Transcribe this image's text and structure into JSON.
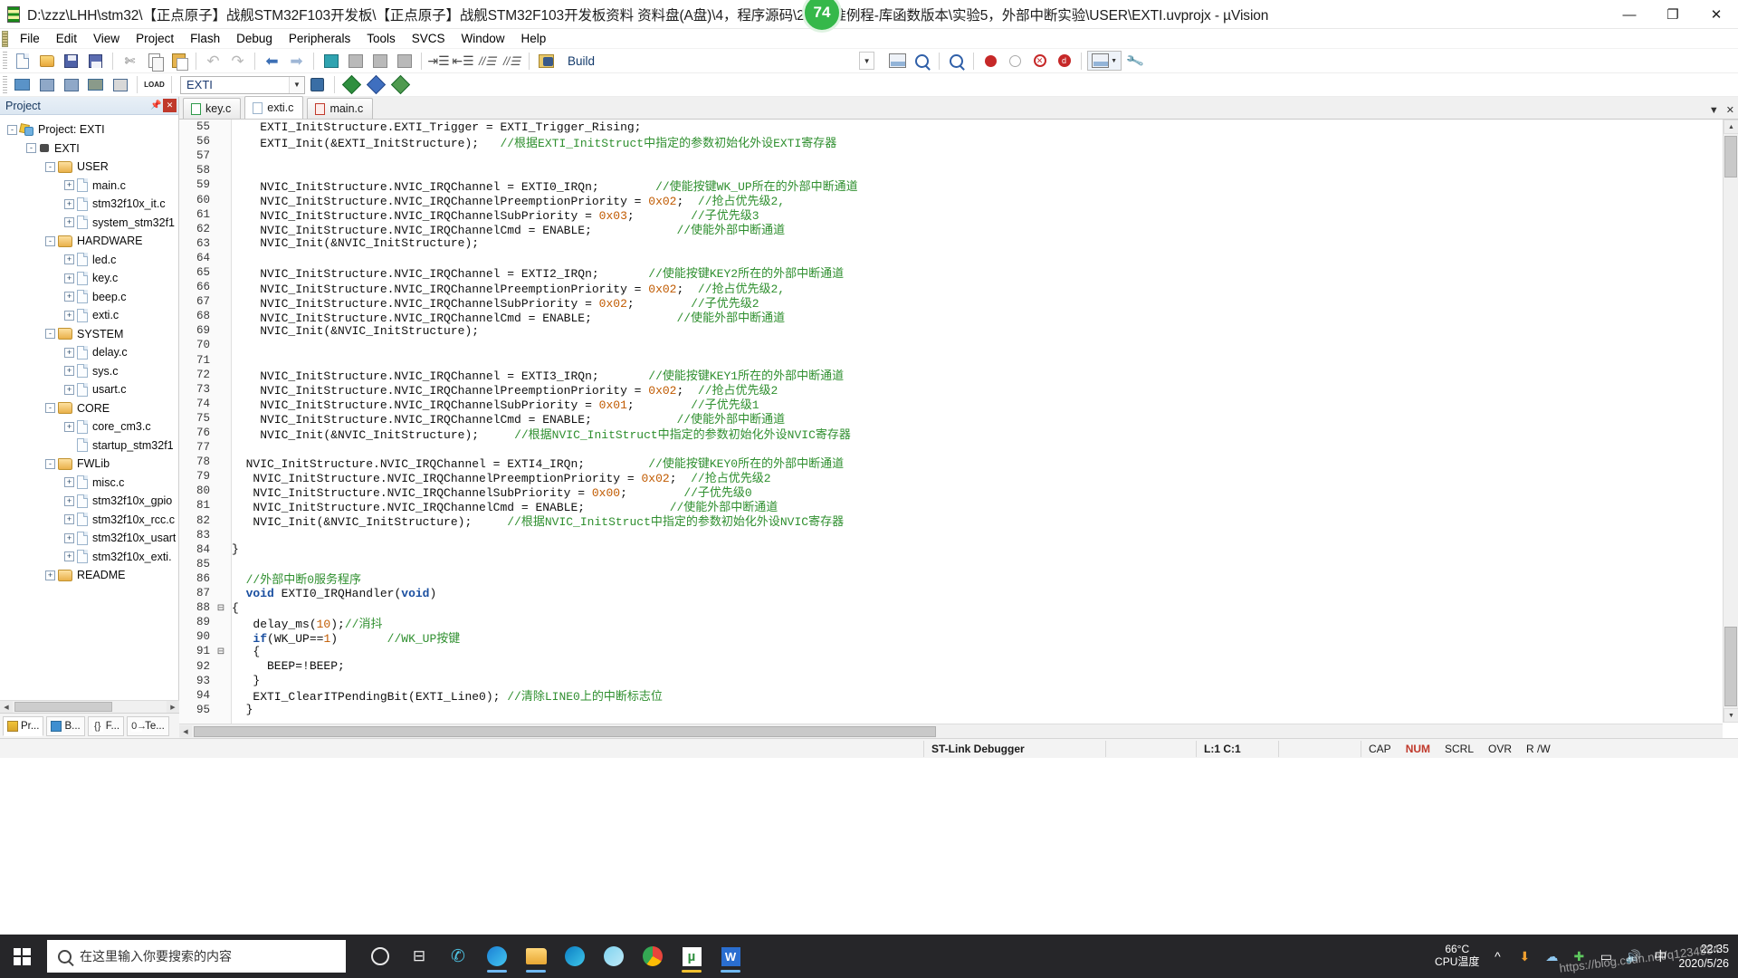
{
  "window": {
    "title": "D:\\zzz\\LHH\\stm32\\【正点原子】战舰STM32F103开发板\\【正点原子】战舰STM32F103开发板资料 资料盘(A盘)\\4，程序源码\\2，标准例程-库函数版本\\实验5，外部中断实验\\USER\\EXTI.uvprojx - µVision",
    "minimize": "—",
    "maximize": "❐",
    "close": "✕",
    "badge_number": "74"
  },
  "menubar": {
    "items": [
      {
        "label": "File"
      },
      {
        "label": "Edit"
      },
      {
        "label": "View"
      },
      {
        "label": "Project"
      },
      {
        "label": "Flash"
      },
      {
        "label": "Debug"
      },
      {
        "label": "Peripherals"
      },
      {
        "label": "Tools"
      },
      {
        "label": "SVCS"
      },
      {
        "label": "Window"
      },
      {
        "label": "Help"
      }
    ]
  },
  "toolbar1": {
    "build_label": "Build",
    "icons": [
      "new-file-icon",
      "open-file-icon",
      "save-icon",
      "save-all-icon",
      "cut-icon",
      "copy-icon",
      "paste-icon",
      "undo-icon",
      "redo-icon",
      "navigate-back-icon",
      "navigate-forward-icon",
      "bookmark-toggle-icon",
      "bookmark-prev-icon",
      "bookmark-next-icon",
      "bookmark-clear-icon",
      "indent-icon",
      "outdent-icon",
      "comment-icon",
      "uncomment-icon",
      "find-in-files-icon",
      "build-target-icon",
      "configure-icon",
      "find-icon",
      "start-debug-icon",
      "insert-breakpoint-icon",
      "kill-breakpoints-icon",
      "disable-breakpoint-icon",
      "manage-window-icon",
      "options-target-icon"
    ]
  },
  "toolbar2": {
    "load_label": "LOAD",
    "target_value": "EXTI",
    "target_placeholder": "EXTI",
    "icons": [
      "download-icon",
      "debug-settings-icon",
      "target-options-icon",
      "batch-build-icon",
      "translate-icon",
      "load-icon",
      "select-target-combo",
      "target-options2-icon",
      "manage-components-icon",
      "pack-installer-icon",
      "window-layout-icon",
      "print-icon"
    ]
  },
  "project_panel": {
    "header": "Project",
    "pin_icon": "pin-icon",
    "close_icon": "close-icon",
    "tree": [
      {
        "label": "Project: EXTI",
        "depth": 0,
        "icon": "project-icon",
        "expander": "-"
      },
      {
        "label": "EXTI",
        "depth": 1,
        "icon": "target-icon",
        "expander": "-"
      },
      {
        "label": "USER",
        "depth": 2,
        "icon": "folder-icon",
        "expander": "-"
      },
      {
        "label": "main.c",
        "depth": 3,
        "icon": "c-file-icon",
        "expander": "+"
      },
      {
        "label": "stm32f10x_it.c",
        "depth": 3,
        "icon": "c-file-icon",
        "expander": "+"
      },
      {
        "label": "system_stm32f1",
        "depth": 3,
        "icon": "c-file-icon",
        "expander": "+"
      },
      {
        "label": "HARDWARE",
        "depth": 2,
        "icon": "folder-icon",
        "expander": "-"
      },
      {
        "label": "led.c",
        "depth": 3,
        "icon": "c-file-icon",
        "expander": "+"
      },
      {
        "label": "key.c",
        "depth": 3,
        "icon": "c-file-icon",
        "expander": "+"
      },
      {
        "label": "beep.c",
        "depth": 3,
        "icon": "c-file-icon",
        "expander": "+"
      },
      {
        "label": "exti.c",
        "depth": 3,
        "icon": "c-file-icon",
        "expander": "+"
      },
      {
        "label": "SYSTEM",
        "depth": 2,
        "icon": "folder-icon",
        "expander": "-"
      },
      {
        "label": "delay.c",
        "depth": 3,
        "icon": "c-file-icon",
        "expander": "+"
      },
      {
        "label": "sys.c",
        "depth": 3,
        "icon": "c-file-icon",
        "expander": "+"
      },
      {
        "label": "usart.c",
        "depth": 3,
        "icon": "c-file-icon",
        "expander": "+"
      },
      {
        "label": "CORE",
        "depth": 2,
        "icon": "folder-icon",
        "expander": "-"
      },
      {
        "label": "core_cm3.c",
        "depth": 3,
        "icon": "c-file-icon",
        "expander": "+"
      },
      {
        "label": "startup_stm32f1",
        "depth": 3,
        "icon": "asm-file-icon",
        "expander": ""
      },
      {
        "label": "FWLib",
        "depth": 2,
        "icon": "folder-icon",
        "expander": "-"
      },
      {
        "label": "misc.c",
        "depth": 3,
        "icon": "c-file-icon",
        "expander": "+"
      },
      {
        "label": "stm32f10x_gpio",
        "depth": 3,
        "icon": "c-file-icon",
        "expander": "+"
      },
      {
        "label": "stm32f10x_rcc.c",
        "depth": 3,
        "icon": "c-file-icon",
        "expander": "+"
      },
      {
        "label": "stm32f10x_usart",
        "depth": 3,
        "icon": "c-file-icon",
        "expander": "+"
      },
      {
        "label": "stm32f10x_exti.",
        "depth": 3,
        "icon": "c-file-icon",
        "expander": "+"
      },
      {
        "label": "README",
        "depth": 2,
        "icon": "folder-icon",
        "expander": "+"
      }
    ],
    "bottom_tabs": [
      {
        "label": "Pr...",
        "icon": "project-tab-icon",
        "active": true
      },
      {
        "label": "B...",
        "icon": "books-tab-icon",
        "active": false
      },
      {
        "label": "F...",
        "icon": "functions-tab-icon",
        "active": false
      },
      {
        "label": "Te...",
        "icon": "templates-tab-icon",
        "active": false
      }
    ]
  },
  "editor": {
    "tabs": [
      {
        "label": "key.c",
        "active": false,
        "icon": "c-file-icon"
      },
      {
        "label": "exti.c",
        "active": true,
        "icon": "c-file-icon"
      },
      {
        "label": "main.c",
        "active": false,
        "icon": "c-file-icon"
      }
    ],
    "tab_controls": {
      "prev": "▼",
      "close": "✕"
    },
    "first_line": 55,
    "lines": [
      {
        "n": 55,
        "fold": "",
        "html": "<span class='ctext'>    EXTI_InitStructure.EXTI_Trigger = EXTI_Trigger_Rising;</span>"
      },
      {
        "n": 56,
        "fold": "",
        "html": "<span class='ctext'>    EXTI_Init(&amp;EXTI_InitStructure);   <span class='cm'>//根据EXTI_InitStruct中指定的参数初始化外设EXTI寄存器</span></span>"
      },
      {
        "n": 57,
        "fold": "",
        "html": "<span class='ctext'></span>"
      },
      {
        "n": 58,
        "fold": "",
        "html": "<span class='ctext'></span>"
      },
      {
        "n": 59,
        "fold": "",
        "html": "<span class='ctext'>    NVIC_InitStructure.NVIC_IRQChannel = EXTI0_IRQn;        <span class='cm'>//使能按键WK_UP所在的外部中断通道</span></span>"
      },
      {
        "n": 60,
        "fold": "",
        "html": "<span class='ctext'>    NVIC_InitStructure.NVIC_IRQChannelPreemptionPriority = <span class='num'>0x02</span>;  <span class='cm'>//抢占优先级2,</span></span>"
      },
      {
        "n": 61,
        "fold": "",
        "html": "<span class='ctext'>    NVIC_InitStructure.NVIC_IRQChannelSubPriority = <span class='num'>0x03</span>;        <span class='cm'>//子优先级3</span></span>"
      },
      {
        "n": 62,
        "fold": "",
        "html": "<span class='ctext'>    NVIC_InitStructure.NVIC_IRQChannelCmd = ENABLE;            <span class='cm'>//使能外部中断通道</span></span>"
      },
      {
        "n": 63,
        "fold": "",
        "html": "<span class='ctext'>    NVIC_Init(&amp;NVIC_InitStructure);</span>"
      },
      {
        "n": 64,
        "fold": "",
        "html": "<span class='ctext'></span>"
      },
      {
        "n": 65,
        "fold": "",
        "html": "<span class='ctext'>    NVIC_InitStructure.NVIC_IRQChannel = EXTI2_IRQn;       <span class='cm'>//使能按键KEY2所在的外部中断通道</span></span>"
      },
      {
        "n": 66,
        "fold": "",
        "html": "<span class='ctext'>    NVIC_InitStructure.NVIC_IRQChannelPreemptionPriority = <span class='num'>0x02</span>;  <span class='cm'>//抢占优先级2,</span></span>"
      },
      {
        "n": 67,
        "fold": "",
        "html": "<span class='ctext'>    NVIC_InitStructure.NVIC_IRQChannelSubPriority = <span class='num'>0x02</span>;        <span class='cm'>//子优先级2</span></span>"
      },
      {
        "n": 68,
        "fold": "",
        "html": "<span class='ctext'>    NVIC_InitStructure.NVIC_IRQChannelCmd = ENABLE;            <span class='cm'>//使能外部中断通道</span></span>"
      },
      {
        "n": 69,
        "fold": "",
        "html": "<span class='ctext'>    NVIC_Init(&amp;NVIC_InitStructure);</span>"
      },
      {
        "n": 70,
        "fold": "",
        "html": "<span class='ctext'></span>"
      },
      {
        "n": 71,
        "fold": "",
        "html": "<span class='ctext'></span>"
      },
      {
        "n": 72,
        "fold": "",
        "html": "<span class='ctext'>    NVIC_InitStructure.NVIC_IRQChannel = EXTI3_IRQn;       <span class='cm'>//使能按键KEY1所在的外部中断通道</span></span>"
      },
      {
        "n": 73,
        "fold": "",
        "html": "<span class='ctext'>    NVIC_InitStructure.NVIC_IRQChannelPreemptionPriority = <span class='num'>0x02</span>;  <span class='cm'>//抢占优先级2</span></span>"
      },
      {
        "n": 74,
        "fold": "",
        "html": "<span class='ctext'>    NVIC_InitStructure.NVIC_IRQChannelSubPriority = <span class='num'>0x01</span>;        <span class='cm'>//子优先级1</span></span>"
      },
      {
        "n": 75,
        "fold": "",
        "html": "<span class='ctext'>    NVIC_InitStructure.NVIC_IRQChannelCmd = ENABLE;            <span class='cm'>//使能外部中断通道</span></span>"
      },
      {
        "n": 76,
        "fold": "",
        "html": "<span class='ctext'>    NVIC_Init(&amp;NVIC_InitStructure);     <span class='cm'>//根据NVIC_InitStruct中指定的参数初始化外设NVIC寄存器</span></span>"
      },
      {
        "n": 77,
        "fold": "",
        "html": "<span class='ctext'></span>"
      },
      {
        "n": 78,
        "fold": "",
        "html": "<span class='ctext'>  NVIC_InitStructure.NVIC_IRQChannel = EXTI4_IRQn;         <span class='cm'>//使能按键KEY0所在的外部中断通道</span></span>"
      },
      {
        "n": 79,
        "fold": "",
        "html": "<span class='ctext'>   NVIC_InitStructure.NVIC_IRQChannelPreemptionPriority = <span class='num'>0x02</span>;  <span class='cm'>//抢占优先级2</span></span>"
      },
      {
        "n": 80,
        "fold": "",
        "html": "<span class='ctext'>   NVIC_InitStructure.NVIC_IRQChannelSubPriority = <span class='num'>0x00</span>;        <span class='cm'>//子优先级0</span></span>"
      },
      {
        "n": 81,
        "fold": "",
        "html": "<span class='ctext'>   NVIC_InitStructure.NVIC_IRQChannelCmd = ENABLE;            <span class='cm'>//使能外部中断通道</span></span>"
      },
      {
        "n": 82,
        "fold": "",
        "html": "<span class='ctext'>   NVIC_Init(&amp;NVIC_InitStructure);     <span class='cm'>//根据NVIC_InitStruct中指定的参数初始化外设NVIC寄存器</span></span>"
      },
      {
        "n": 83,
        "fold": "",
        "html": "<span class='ctext'></span>"
      },
      {
        "n": 84,
        "fold": "",
        "html": "<span class='ctext'>}</span>"
      },
      {
        "n": 85,
        "fold": "",
        "html": "<span class='ctext'></span>"
      },
      {
        "n": 86,
        "fold": "",
        "html": "<span class='ctext'>  <span class='cm'>//外部中断0服务程序</span></span>"
      },
      {
        "n": 87,
        "fold": "",
        "html": "<span class='ctext'>  <span class='kw'>void</span> EXTI0_IRQHandler(<span class='kw'>void</span>)</span>"
      },
      {
        "n": 88,
        "fold": "-",
        "html": "<span class='ctext'>{</span>"
      },
      {
        "n": 89,
        "fold": "",
        "html": "<span class='ctext'>   delay_ms(<span class='num'>10</span>);<span class='cm'>//消抖</span></span>"
      },
      {
        "n": 90,
        "fold": "",
        "html": "<span class='ctext'>   <span class='kw'>if</span>(WK_UP==<span class='num'>1</span>)       <span class='cm'>//WK_UP按键</span></span>"
      },
      {
        "n": 91,
        "fold": "-",
        "html": "<span class='ctext'>   {</span>"
      },
      {
        "n": 92,
        "fold": "",
        "html": "<span class='ctext'>     BEEP=!BEEP;</span>"
      },
      {
        "n": 93,
        "fold": "",
        "html": "<span class='ctext'>   }</span>"
      },
      {
        "n": 94,
        "fold": "",
        "html": "<span class='ctext'>   EXTI_ClearITPendingBit(EXTI_Line0); <span class='cm'>//清除LINE0上的中断标志位</span></span>"
      },
      {
        "n": 95,
        "fold": "",
        "html": "<span class='ctext'>  }</span>"
      }
    ]
  },
  "statusbar": {
    "debugger": "ST-Link Debugger",
    "position": "L:1 C:1",
    "indicators": [
      "CAP",
      "NUM",
      "SCRL",
      "OVR",
      "R /W"
    ]
  },
  "taskbar": {
    "search_placeholder": "在这里输入你要搜索的内容",
    "start_icon": "windows-start-icon",
    "search_icon": "search-icon",
    "apps": [
      {
        "name": "cortana-icon"
      },
      {
        "name": "task-view-icon"
      },
      {
        "name": "wechat-work-icon"
      },
      {
        "name": "edge-legacy-icon"
      },
      {
        "name": "file-explorer-icon"
      },
      {
        "name": "edge-icon"
      },
      {
        "name": "qq-icon"
      },
      {
        "name": "chrome-icon"
      },
      {
        "name": "keil-uvision-icon"
      },
      {
        "name": "wps-writer-icon"
      }
    ],
    "tray": {
      "cpu_temp_value": "66°C",
      "cpu_temp_label": "CPU温度",
      "chevron": "^",
      "ime": "中",
      "clock_time": "22:35",
      "clock_date": "2020/5/26"
    },
    "watermark": "https://blog.csdn.net/q1234554"
  },
  "colors": {
    "accent": "#35b84a",
    "keyword": "#1a4fa0",
    "comment": "#2f8f2f",
    "number": "#c05a00",
    "panel_header": "#17375e"
  }
}
